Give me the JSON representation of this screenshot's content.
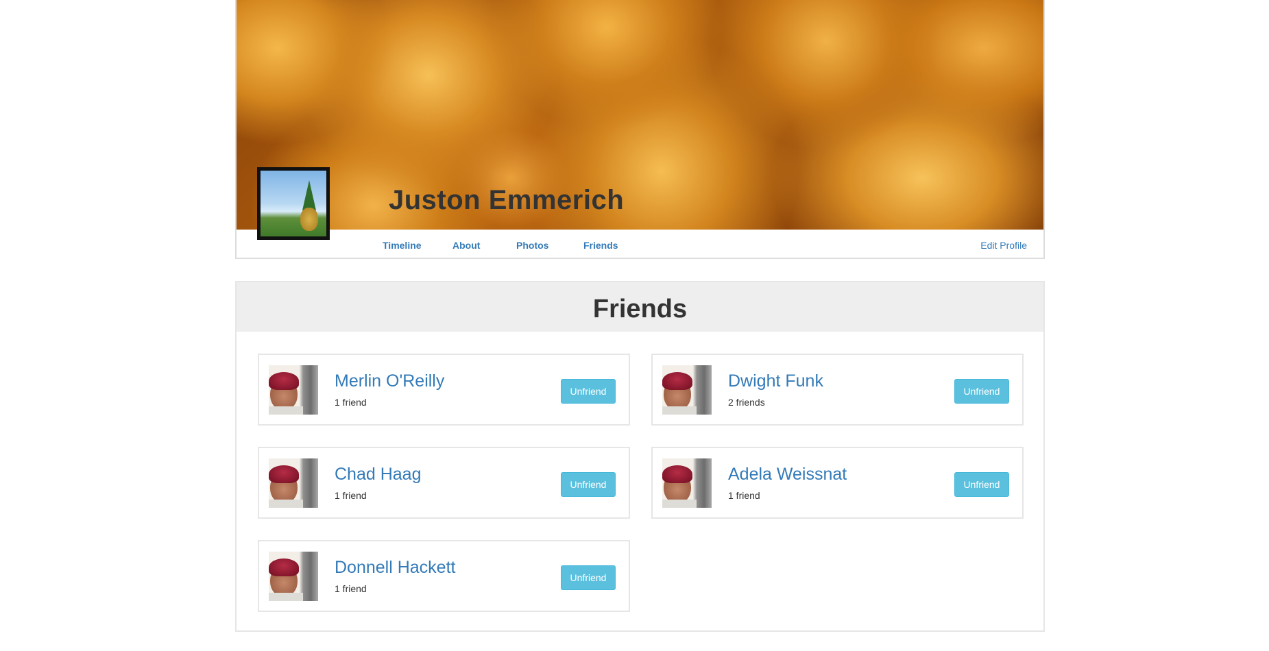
{
  "profile": {
    "name": "Juston Emmerich",
    "nav": {
      "timeline": "Timeline",
      "about": "About",
      "photos": "Photos",
      "friends": "Friends",
      "edit_profile": "Edit Profile"
    }
  },
  "friends_panel": {
    "title": "Friends",
    "button_label": "Unfriend",
    "items": [
      {
        "name": "Merlin O'Reilly",
        "count": "1 friend"
      },
      {
        "name": "Dwight Funk",
        "count": "2 friends"
      },
      {
        "name": "Chad Haag",
        "count": "1 friend"
      },
      {
        "name": "Adela Weissnat",
        "count": "1 friend"
      },
      {
        "name": "Donnell Hackett",
        "count": "1 friend"
      }
    ]
  },
  "colors": {
    "link": "#337ab7",
    "button": "#5bc0de",
    "panel_heading": "#eeeeee"
  }
}
